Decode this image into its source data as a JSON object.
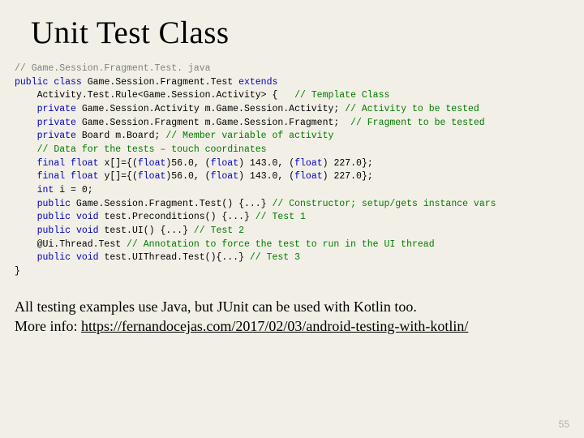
{
  "title": "Unit Test Class",
  "code": {
    "l1a": "// Game.Session.Fragment.Test. java",
    "l2a": "public",
    "l2b": " ",
    "l2c": "class",
    "l2d": " Game.Session.Fragment.Test ",
    "l2e": "extends",
    "l3a": "    Activity.Test.Rule<Game.Session.Activity> {   ",
    "l3b": "// Template Class",
    "l4a": "    ",
    "l4b": "private",
    "l4c": " Game.Session.Activity m.Game.Session.Activity; ",
    "l4d": "// Activity to be tested",
    "l5a": "    ",
    "l5b": "private",
    "l5c": " Game.Session.Fragment m.Game.Session.Fragment;  ",
    "l5d": "// Fragment to be tested",
    "l6a": "    ",
    "l6b": "private",
    "l6c": " Board m.Board; ",
    "l6d": "// Member variable of activity",
    "l7a": "    ",
    "l7b": "// Data for the tests – touch coordinates",
    "l8a": "    ",
    "l8b": "final",
    "l8c": " ",
    "l8d": "float",
    "l8e": " x[]={(",
    "l8f": "float",
    "l8g": ")56.0, (",
    "l8h": "float",
    "l8i": ") 143.0, (",
    "l8j": "float",
    "l8k": ") 227.0};",
    "l9a": "    ",
    "l9b": "final",
    "l9c": " ",
    "l9d": "float",
    "l9e": " y[]={(",
    "l9f": "float",
    "l9g": ")56.0, (",
    "l9h": "float",
    "l9i": ") 143.0, (",
    "l9j": "float",
    "l9k": ") 227.0};",
    "l10a": "    ",
    "l10b": "int",
    "l10c": " i = 0;",
    "l11a": "    ",
    "l11b": "public",
    "l11c": " Game.Session.Fragment.Test() {...} ",
    "l11d": "// Constructor; setup/gets instance vars",
    "l12a": "    ",
    "l12b": "public",
    "l12c": " ",
    "l12d": "void",
    "l12e": " test.Preconditions() {...} ",
    "l12f": "// Test 1",
    "l13a": "    ",
    "l13b": "public",
    "l13c": " ",
    "l13d": "void",
    "l13e": " test.UI() {...} ",
    "l13f": "// Test 2",
    "l14a": "    @Ui.Thread.Test ",
    "l14b": "// Annotation to force the test to run in the UI thread",
    "l15a": "    ",
    "l15b": "public",
    "l15c": " ",
    "l15d": "void",
    "l15e": " test.UIThread.Test(){...} ",
    "l15f": "// Test 3",
    "l16": "}"
  },
  "footer": {
    "line1": "All testing examples use Java, but JUnit can be used with Kotlin too.",
    "line2_prefix": "More info: ",
    "link_text": "https://fernandocejas.com/2017/02/03/android-testing-with-kotlin/"
  },
  "page_number": "55"
}
